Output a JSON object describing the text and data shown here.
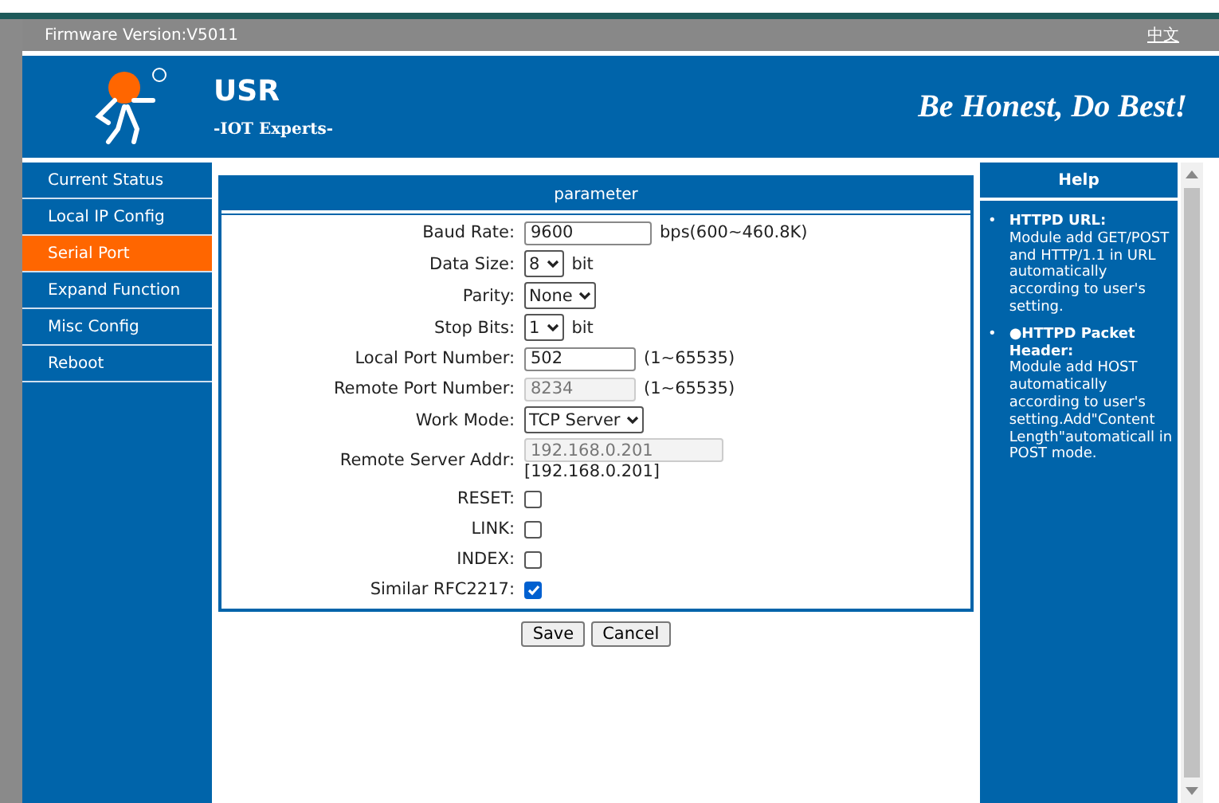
{
  "top_bar": {
    "firmware": "Firmware Version:V5011",
    "language_link": "中文"
  },
  "header": {
    "brand": "USR",
    "tagline": "-IOT Experts-",
    "slogan": "Be Honest, Do Best!"
  },
  "sidebar": {
    "items": [
      {
        "label": "Current Status",
        "selected": false
      },
      {
        "label": "Local IP Config",
        "selected": false
      },
      {
        "label": "Serial Port",
        "selected": true
      },
      {
        "label": "Expand Function",
        "selected": false
      },
      {
        "label": "Misc Config",
        "selected": false
      },
      {
        "label": "Reboot",
        "selected": false
      }
    ]
  },
  "form": {
    "title": "parameter",
    "rows": [
      {
        "kind": "text",
        "label": "Baud Rate:",
        "value": "9600",
        "hint": "bps(600~460.8K)",
        "disabled": false
      },
      {
        "kind": "select",
        "label": "Data Size:",
        "value": "8",
        "hint": "bit"
      },
      {
        "kind": "select",
        "label": "Parity:",
        "value": "None"
      },
      {
        "kind": "select",
        "label": "Stop Bits:",
        "value": "1",
        "hint": "bit"
      },
      {
        "kind": "text",
        "label": "Local Port Number:",
        "value": "502",
        "hint": "(1~65535)",
        "disabled": false
      },
      {
        "kind": "text",
        "label": "Remote Port Number:",
        "value": "8234",
        "hint": "(1~65535)",
        "disabled": true
      },
      {
        "kind": "select",
        "label": "Work Mode:",
        "value": "TCP Server"
      },
      {
        "kind": "address",
        "label": "Remote Server Addr:",
        "value": "192.168.0.201",
        "hint": "[192.168.0.201]",
        "disabled": true
      },
      {
        "kind": "checkbox",
        "label": "RESET:",
        "checked": false
      },
      {
        "kind": "checkbox",
        "label": "LINK:",
        "checked": false
      },
      {
        "kind": "checkbox",
        "label": "INDEX:",
        "checked": false
      },
      {
        "kind": "checkbox",
        "label": "Similar RFC2217:",
        "checked": true
      }
    ],
    "buttons": [
      "Save",
      "Cancel"
    ]
  },
  "help": {
    "title": "Help",
    "items": [
      {
        "marker": "•",
        "title": "HTTPD URL:",
        "body": "Module add GET/POST and HTTP/1.1 in URL automatically according to user's setting."
      },
      {
        "marker": "•",
        "title": "●HTTPD Packet Header:",
        "body": "Module add HOST automatically according to user's setting.Add\"Content Length\"automaticall in POST mode."
      }
    ]
  }
}
